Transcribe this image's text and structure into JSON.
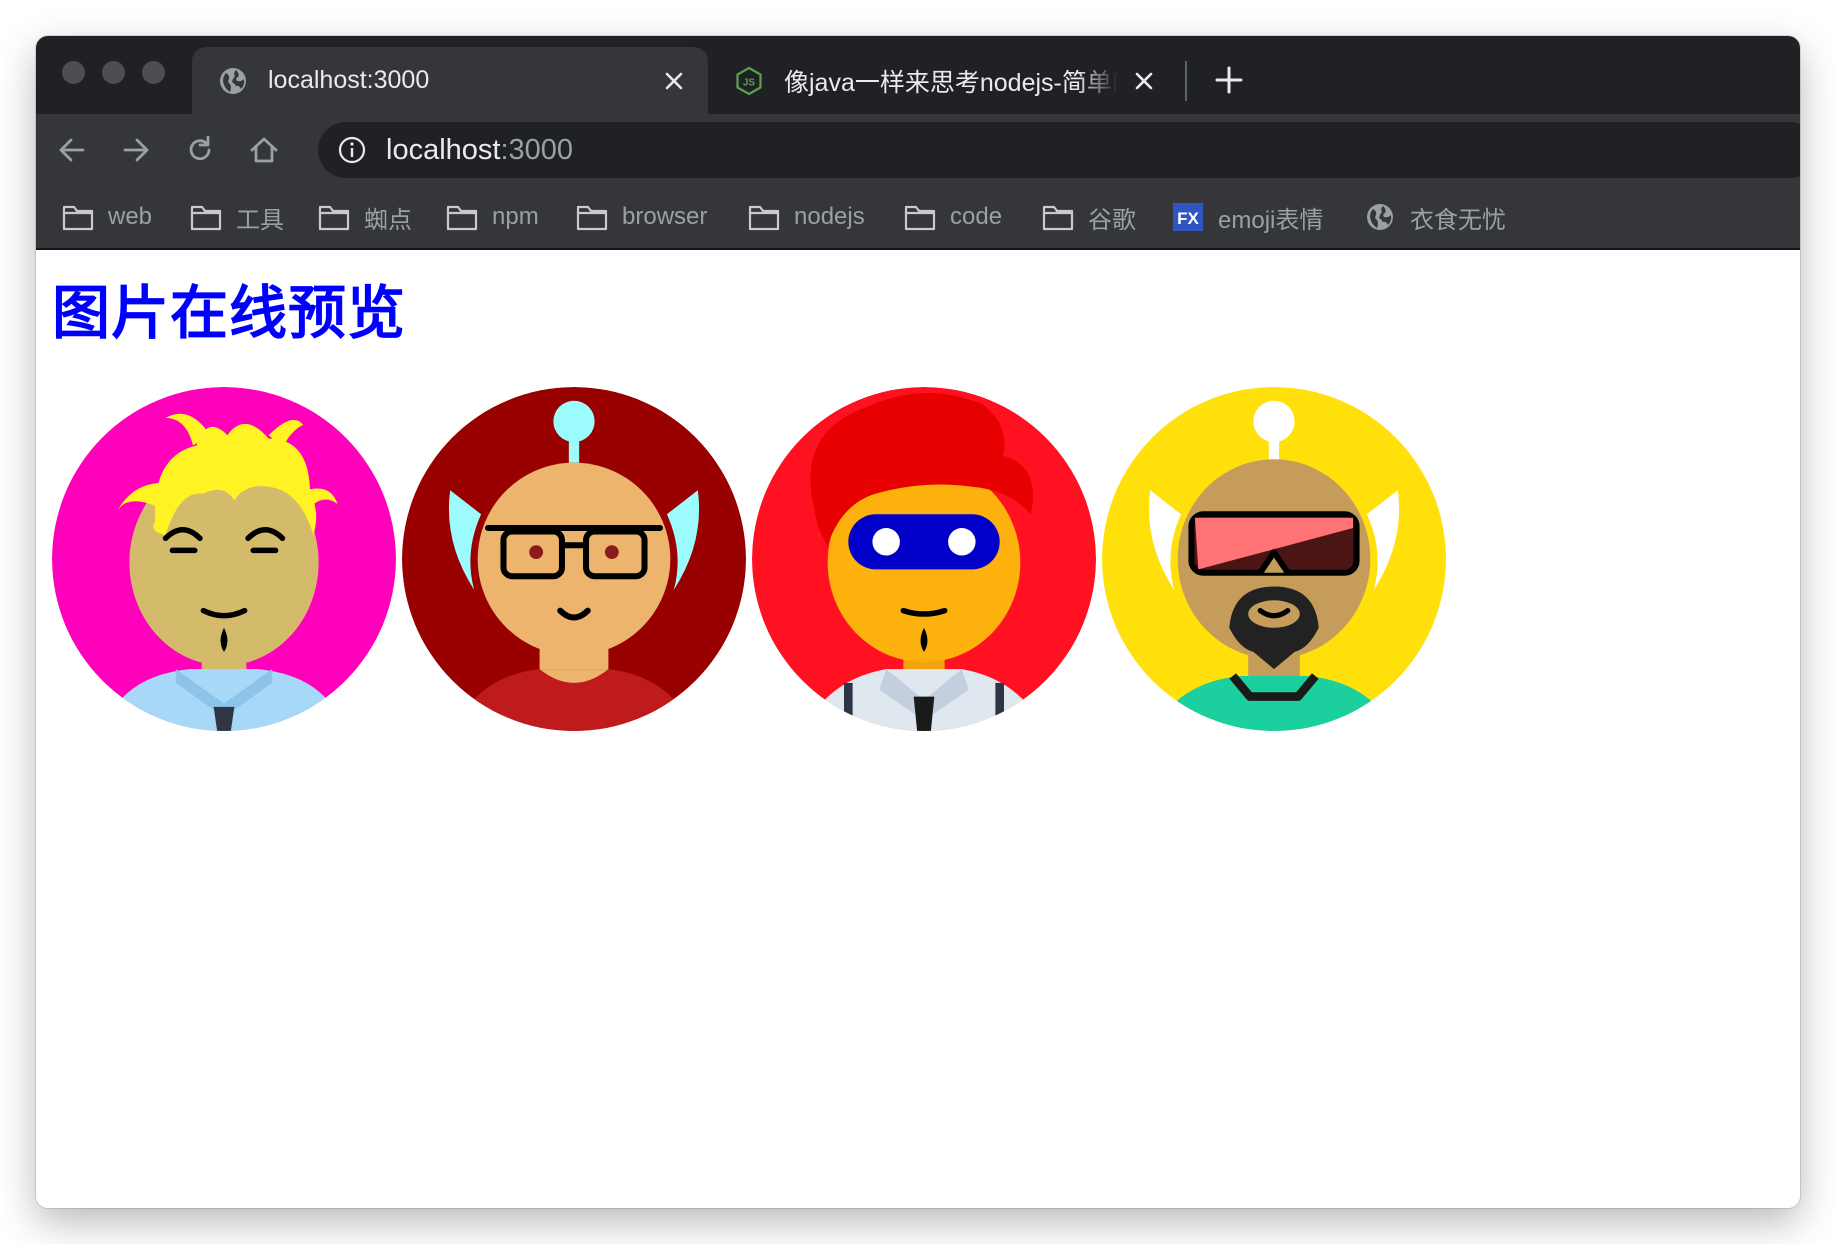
{
  "browser": {
    "tabs": [
      {
        "title": "localhost:3000",
        "favicon": "globe-icon",
        "active": true
      },
      {
        "title": "像java一样来思考nodejs-简单的",
        "favicon": "nodejs-icon",
        "active": false
      }
    ],
    "address": {
      "host": "localhost",
      "port": ":3000"
    },
    "bookmarks": [
      {
        "label": "web",
        "icon": "folder-icon"
      },
      {
        "label": "工具",
        "icon": "folder-icon"
      },
      {
        "label": "蜘点",
        "icon": "folder-icon"
      },
      {
        "label": "npm",
        "icon": "folder-icon"
      },
      {
        "label": "browser",
        "icon": "folder-icon"
      },
      {
        "label": "nodejs",
        "icon": "folder-icon"
      },
      {
        "label": "code",
        "icon": "folder-icon"
      },
      {
        "label": "谷歌",
        "icon": "folder-icon"
      },
      {
        "label": "emoji表情",
        "icon": "fx-icon"
      },
      {
        "label": "衣食无忧",
        "icon": "globe-icon"
      }
    ]
  },
  "page": {
    "heading": "图片在线预览",
    "heading_color": "#0000ff",
    "avatars": [
      {
        "name": "avatar-blonde-man",
        "background": "#ff00bb"
      },
      {
        "name": "avatar-glasses-man",
        "background": "#990000"
      },
      {
        "name": "avatar-masked-man",
        "background": "#ff1122"
      },
      {
        "name": "avatar-sunglasses-man",
        "background": "#ffe00a"
      }
    ]
  }
}
